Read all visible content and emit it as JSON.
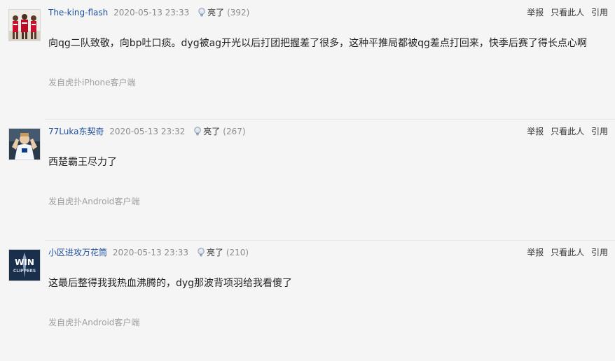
{
  "actions": {
    "report": "举报",
    "only_this": "只看此人",
    "quote": "引用"
  },
  "light_label": "亮了",
  "icons": {
    "light": "lightbulb-icon"
  },
  "colors": {
    "username": "#1e4f9c",
    "muted": "#8c8c8c",
    "background": "#f5f5f5"
  },
  "posts": [
    {
      "username": "The-king-flash",
      "time": "2020-05-13 23:33",
      "light_count": "(392)",
      "content": "向qg二队致敬，向bp吐口痰。dyg被ag开光以后打团把握差了很多，这种平推局都被qg差点打回来，快季后赛了得长点心啊",
      "source": "发自虎扑iPhone客户端",
      "avatar": "team-photo-avatar"
    },
    {
      "username": "77Luka东契奇",
      "time": "2020-05-13 23:32",
      "light_count": "(267)",
      "content": "西楚霸王尽力了",
      "source": "发自虎扑Android客户端",
      "avatar": "player-photo-avatar"
    },
    {
      "username": "小区进攻万花筒",
      "time": "2020-05-13 23:33",
      "light_count": "(210)",
      "content": "这最后整得我我热血沸腾的，dyg那波背项羽给我看傻了",
      "source": "发自虎扑Android客户端",
      "avatar": "clippers-logo-avatar"
    }
  ]
}
